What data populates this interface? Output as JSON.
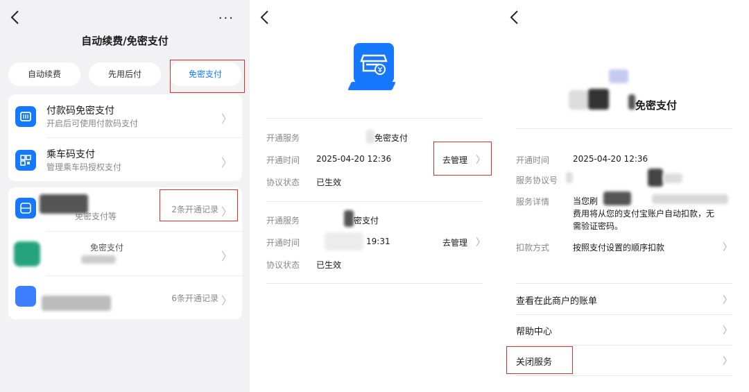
{
  "panel1": {
    "title": "自动续费/免密支付",
    "more": "···",
    "tabs": [
      "自动续费",
      "先用后付",
      "免密支付"
    ],
    "items": [
      {
        "title": "付款码免密支付",
        "subtitle": "开启后可使用付款码支付"
      },
      {
        "title": "乘车码支付",
        "subtitle": "管理乘车码授权支付"
      }
    ],
    "merchants": [
      {
        "subtitle": "免密支付等",
        "right": "2条开通记录"
      },
      {
        "subtitle": "免密支付",
        "right": ""
      },
      {
        "subtitle": "",
        "right": "6条开通记录"
      }
    ]
  },
  "panel2": {
    "records": [
      {
        "k1": "开通服务",
        "v1": "免密支付",
        "k2": "开通时间",
        "v2": "2025-04-20 12:36",
        "action": "去管理",
        "k3": "协议状态",
        "v3": "已生效"
      },
      {
        "k1": "开通服务",
        "v1": "密支付",
        "k2": "开通时间",
        "v2": "19:31",
        "action": "去管理",
        "k3": "协议状态",
        "v3": "已生效"
      }
    ]
  },
  "panel3": {
    "title_suffix": "免密支付",
    "fields": [
      {
        "k": "开通时间",
        "v": "2025-04-20 12:36"
      },
      {
        "k": "服务协议号",
        "v": ""
      },
      {
        "k": "服务详情",
        "v": "当您刷",
        "v2": "费用将从您的支付宝账户自动扣款，无",
        "v3": "需验证密码。"
      },
      {
        "k": "扣款方式",
        "v": "按照支付设置的顺序扣款"
      }
    ],
    "links": [
      "查看在此商户的账单",
      "帮助中心",
      "关闭服务"
    ]
  },
  "colors": {
    "accent": "#1677ff",
    "highlight": "#d9302c"
  }
}
